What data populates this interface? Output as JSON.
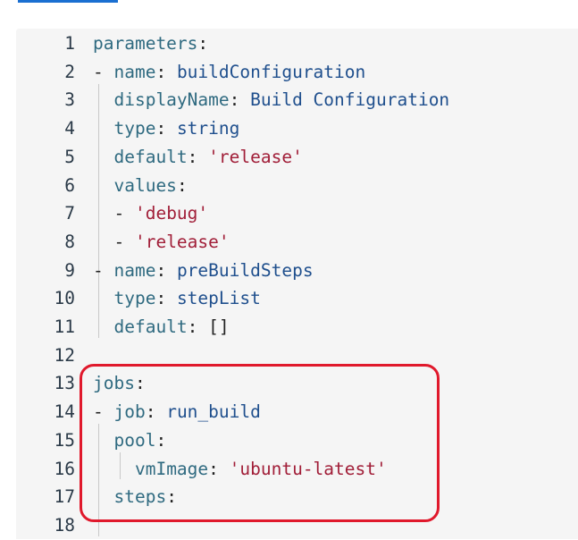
{
  "editor": {
    "lines": [
      {
        "n": "1",
        "parts": [
          {
            "t": "parameters",
            "c": "key"
          },
          {
            "t": ":",
            "c": "punc"
          }
        ]
      },
      {
        "n": "2",
        "parts": [
          {
            "t": "- ",
            "c": "punc"
          },
          {
            "t": "name",
            "c": "key"
          },
          {
            "t": ": ",
            "c": "punc"
          },
          {
            "t": "buildConfiguration",
            "c": "val"
          }
        ]
      },
      {
        "n": "3",
        "parts": [
          {
            "t": "  ",
            "c": "punc"
          },
          {
            "t": "displayName",
            "c": "key"
          },
          {
            "t": ": ",
            "c": "punc"
          },
          {
            "t": "Build Configuration",
            "c": "val"
          }
        ]
      },
      {
        "n": "4",
        "parts": [
          {
            "t": "  ",
            "c": "punc"
          },
          {
            "t": "type",
            "c": "key"
          },
          {
            "t": ": ",
            "c": "punc"
          },
          {
            "t": "string",
            "c": "val"
          }
        ]
      },
      {
        "n": "5",
        "parts": [
          {
            "t": "  ",
            "c": "punc"
          },
          {
            "t": "default",
            "c": "key"
          },
          {
            "t": ": ",
            "c": "punc"
          },
          {
            "t": "'release'",
            "c": "str"
          }
        ]
      },
      {
        "n": "6",
        "parts": [
          {
            "t": "  ",
            "c": "punc"
          },
          {
            "t": "values",
            "c": "key"
          },
          {
            "t": ":",
            "c": "punc"
          }
        ]
      },
      {
        "n": "7",
        "parts": [
          {
            "t": "  - ",
            "c": "punc"
          },
          {
            "t": "'debug'",
            "c": "str"
          }
        ]
      },
      {
        "n": "8",
        "parts": [
          {
            "t": "  - ",
            "c": "punc"
          },
          {
            "t": "'release'",
            "c": "str"
          }
        ]
      },
      {
        "n": "9",
        "parts": [
          {
            "t": "- ",
            "c": "punc"
          },
          {
            "t": "name",
            "c": "key"
          },
          {
            "t": ": ",
            "c": "punc"
          },
          {
            "t": "preBuildSteps",
            "c": "val"
          }
        ]
      },
      {
        "n": "10",
        "parts": [
          {
            "t": "  ",
            "c": "punc"
          },
          {
            "t": "type",
            "c": "key"
          },
          {
            "t": ": ",
            "c": "punc"
          },
          {
            "t": "stepList",
            "c": "val"
          }
        ]
      },
      {
        "n": "11",
        "parts": [
          {
            "t": "  ",
            "c": "punc"
          },
          {
            "t": "default",
            "c": "key"
          },
          {
            "t": ": ",
            "c": "punc"
          },
          {
            "t": "[]",
            "c": "punc"
          }
        ]
      },
      {
        "n": "12",
        "parts": []
      },
      {
        "n": "13",
        "parts": [
          {
            "t": "jobs",
            "c": "key"
          },
          {
            "t": ":",
            "c": "punc"
          }
        ]
      },
      {
        "n": "14",
        "parts": [
          {
            "t": "- ",
            "c": "punc"
          },
          {
            "t": "job",
            "c": "key"
          },
          {
            "t": ": ",
            "c": "punc"
          },
          {
            "t": "run_build",
            "c": "val"
          }
        ]
      },
      {
        "n": "15",
        "parts": [
          {
            "t": "  ",
            "c": "punc"
          },
          {
            "t": "pool",
            "c": "key"
          },
          {
            "t": ":",
            "c": "punc"
          }
        ]
      },
      {
        "n": "16",
        "parts": [
          {
            "t": "    ",
            "c": "punc"
          },
          {
            "t": "vmImage",
            "c": "key"
          },
          {
            "t": ": ",
            "c": "punc"
          },
          {
            "t": "'ubuntu-latest'",
            "c": "str"
          }
        ]
      },
      {
        "n": "17",
        "parts": [
          {
            "t": "  ",
            "c": "punc"
          },
          {
            "t": "steps",
            "c": "key"
          },
          {
            "t": ":",
            "c": "punc"
          }
        ]
      },
      {
        "n": "18",
        "parts": []
      }
    ]
  },
  "colors": {
    "highlight_border": "#e0192c",
    "link_bar": "#1a6fd1",
    "panel_background": "#f5f5f5"
  }
}
